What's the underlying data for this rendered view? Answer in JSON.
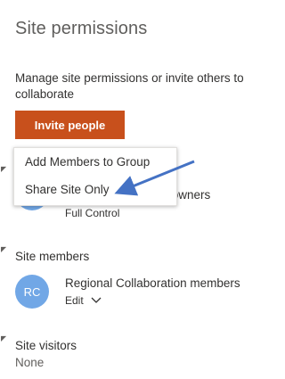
{
  "panel": {
    "title": "Site permissions",
    "description": "Manage site permissions or invite others to collaborate",
    "invite_button": "Invite people"
  },
  "menu": {
    "items": [
      {
        "label": "Add Members to Group"
      },
      {
        "label": "Share Site Only"
      }
    ]
  },
  "owners": {
    "name_partial": "on owners",
    "permission": "Full Control"
  },
  "members": {
    "header": "Site members",
    "avatar_initials": "RC",
    "name": "Regional Collaboration members",
    "permission": "Edit"
  },
  "visitors": {
    "header": "Site visitors",
    "value": "None"
  },
  "colors": {
    "accent": "#c8501c",
    "avatar": "#71a7e6",
    "arrow": "#4472c4"
  },
  "icons": {
    "dropdown": "chevron-down-icon",
    "collapse": "caret-icon"
  }
}
